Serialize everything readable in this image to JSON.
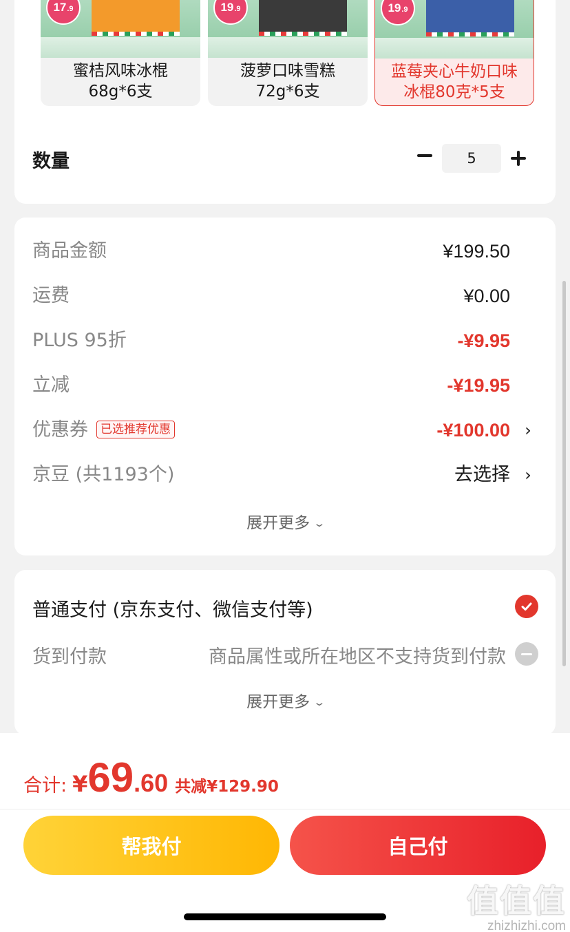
{
  "variants": [
    {
      "badge_int": "17",
      "badge_dec": ".9",
      "label": "蜜桔风味冰棍\n68g*6支",
      "box_color": "#f39a2b",
      "selected": false
    },
    {
      "badge_int": "19",
      "badge_dec": ".9",
      "label": "菠萝口味雪糕\n72g*6支",
      "box_color": "#3a3a3a",
      "selected": false
    },
    {
      "badge_int": "19",
      "badge_dec": ".9",
      "label": "蓝莓夹心牛奶口味\n冰棍80克*5支",
      "box_color": "#3b5fa8",
      "selected": true
    }
  ],
  "quantity": {
    "label": "数量",
    "value": "5"
  },
  "price_rows": {
    "goods": {
      "label": "商品金额",
      "value": "¥199.50"
    },
    "shipping": {
      "label": "运费",
      "value": "¥0.00"
    },
    "plus": {
      "label": "PLUS 95折",
      "value": "-¥9.95"
    },
    "instant": {
      "label": "立减",
      "value": "-¥19.95"
    },
    "coupon": {
      "label": "优惠券",
      "tag": "已选推荐优惠",
      "value": "-¥100.00"
    },
    "beans": {
      "label": "京豆 (共1193个)",
      "value": "去选择"
    }
  },
  "expand_more": "展开更多",
  "payment": {
    "normal": "普通支付 (京东支付、微信支付等)",
    "cod_label": "货到付款",
    "cod_note": "商品属性或所在地区不支持货到付款"
  },
  "footer": {
    "total_label": "合计:",
    "currency": "¥",
    "total_int": "69",
    "total_dec": ".60",
    "saved": "共减¥129.90",
    "help_pay": "帮我付",
    "self_pay": "自己付"
  },
  "watermark": {
    "main": "值值值",
    "sub": "zhizhizhi.com"
  },
  "colors": {
    "accent": "#e2372d",
    "help_button": "#ffc41f",
    "self_button": "#ef3a36"
  },
  "icons": {
    "chevron": "chevron-right-icon",
    "check": "checkmark-circle-icon",
    "disabled": "minus-circle-icon"
  }
}
